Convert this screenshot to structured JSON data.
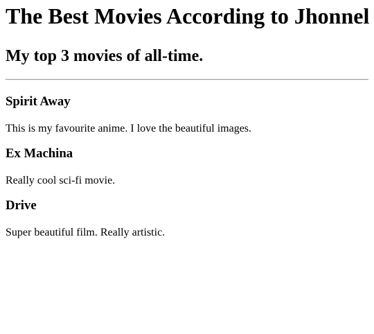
{
  "page": {
    "title": "The Best Movies According to Jhonnel",
    "subtitle": "My top 3 movies of all-time."
  },
  "movies": [
    {
      "title": "Spirit Away",
      "description": "This is my favourite anime. I love the beautiful images."
    },
    {
      "title": "Ex Machina",
      "description": "Really cool sci-fi movie."
    },
    {
      "title": "Drive",
      "description": "Super beautiful film. Really artistic."
    }
  ]
}
